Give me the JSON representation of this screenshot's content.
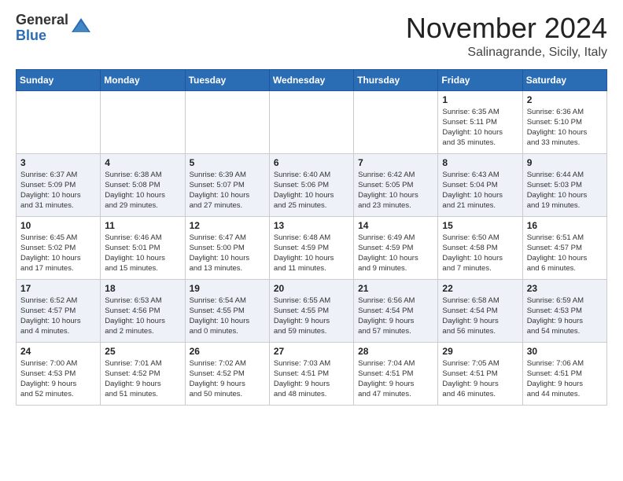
{
  "logo": {
    "general": "General",
    "blue": "Blue"
  },
  "header": {
    "month": "November 2024",
    "location": "Salinagrande, Sicily, Italy"
  },
  "weekdays": [
    "Sunday",
    "Monday",
    "Tuesday",
    "Wednesday",
    "Thursday",
    "Friday",
    "Saturday"
  ],
  "weeks": [
    [
      {
        "day": "",
        "info": ""
      },
      {
        "day": "",
        "info": ""
      },
      {
        "day": "",
        "info": ""
      },
      {
        "day": "",
        "info": ""
      },
      {
        "day": "",
        "info": ""
      },
      {
        "day": "1",
        "info": "Sunrise: 6:35 AM\nSunset: 5:11 PM\nDaylight: 10 hours\nand 35 minutes."
      },
      {
        "day": "2",
        "info": "Sunrise: 6:36 AM\nSunset: 5:10 PM\nDaylight: 10 hours\nand 33 minutes."
      }
    ],
    [
      {
        "day": "3",
        "info": "Sunrise: 6:37 AM\nSunset: 5:09 PM\nDaylight: 10 hours\nand 31 minutes."
      },
      {
        "day": "4",
        "info": "Sunrise: 6:38 AM\nSunset: 5:08 PM\nDaylight: 10 hours\nand 29 minutes."
      },
      {
        "day": "5",
        "info": "Sunrise: 6:39 AM\nSunset: 5:07 PM\nDaylight: 10 hours\nand 27 minutes."
      },
      {
        "day": "6",
        "info": "Sunrise: 6:40 AM\nSunset: 5:06 PM\nDaylight: 10 hours\nand 25 minutes."
      },
      {
        "day": "7",
        "info": "Sunrise: 6:42 AM\nSunset: 5:05 PM\nDaylight: 10 hours\nand 23 minutes."
      },
      {
        "day": "8",
        "info": "Sunrise: 6:43 AM\nSunset: 5:04 PM\nDaylight: 10 hours\nand 21 minutes."
      },
      {
        "day": "9",
        "info": "Sunrise: 6:44 AM\nSunset: 5:03 PM\nDaylight: 10 hours\nand 19 minutes."
      }
    ],
    [
      {
        "day": "10",
        "info": "Sunrise: 6:45 AM\nSunset: 5:02 PM\nDaylight: 10 hours\nand 17 minutes."
      },
      {
        "day": "11",
        "info": "Sunrise: 6:46 AM\nSunset: 5:01 PM\nDaylight: 10 hours\nand 15 minutes."
      },
      {
        "day": "12",
        "info": "Sunrise: 6:47 AM\nSunset: 5:00 PM\nDaylight: 10 hours\nand 13 minutes."
      },
      {
        "day": "13",
        "info": "Sunrise: 6:48 AM\nSunset: 4:59 PM\nDaylight: 10 hours\nand 11 minutes."
      },
      {
        "day": "14",
        "info": "Sunrise: 6:49 AM\nSunset: 4:59 PM\nDaylight: 10 hours\nand 9 minutes."
      },
      {
        "day": "15",
        "info": "Sunrise: 6:50 AM\nSunset: 4:58 PM\nDaylight: 10 hours\nand 7 minutes."
      },
      {
        "day": "16",
        "info": "Sunrise: 6:51 AM\nSunset: 4:57 PM\nDaylight: 10 hours\nand 6 minutes."
      }
    ],
    [
      {
        "day": "17",
        "info": "Sunrise: 6:52 AM\nSunset: 4:57 PM\nDaylight: 10 hours\nand 4 minutes."
      },
      {
        "day": "18",
        "info": "Sunrise: 6:53 AM\nSunset: 4:56 PM\nDaylight: 10 hours\nand 2 minutes."
      },
      {
        "day": "19",
        "info": "Sunrise: 6:54 AM\nSunset: 4:55 PM\nDaylight: 10 hours\nand 0 minutes."
      },
      {
        "day": "20",
        "info": "Sunrise: 6:55 AM\nSunset: 4:55 PM\nDaylight: 9 hours\nand 59 minutes."
      },
      {
        "day": "21",
        "info": "Sunrise: 6:56 AM\nSunset: 4:54 PM\nDaylight: 9 hours\nand 57 minutes."
      },
      {
        "day": "22",
        "info": "Sunrise: 6:58 AM\nSunset: 4:54 PM\nDaylight: 9 hours\nand 56 minutes."
      },
      {
        "day": "23",
        "info": "Sunrise: 6:59 AM\nSunset: 4:53 PM\nDaylight: 9 hours\nand 54 minutes."
      }
    ],
    [
      {
        "day": "24",
        "info": "Sunrise: 7:00 AM\nSunset: 4:53 PM\nDaylight: 9 hours\nand 52 minutes."
      },
      {
        "day": "25",
        "info": "Sunrise: 7:01 AM\nSunset: 4:52 PM\nDaylight: 9 hours\nand 51 minutes."
      },
      {
        "day": "26",
        "info": "Sunrise: 7:02 AM\nSunset: 4:52 PM\nDaylight: 9 hours\nand 50 minutes."
      },
      {
        "day": "27",
        "info": "Sunrise: 7:03 AM\nSunset: 4:51 PM\nDaylight: 9 hours\nand 48 minutes."
      },
      {
        "day": "28",
        "info": "Sunrise: 7:04 AM\nSunset: 4:51 PM\nDaylight: 9 hours\nand 47 minutes."
      },
      {
        "day": "29",
        "info": "Sunrise: 7:05 AM\nSunset: 4:51 PM\nDaylight: 9 hours\nand 46 minutes."
      },
      {
        "day": "30",
        "info": "Sunrise: 7:06 AM\nSunset: 4:51 PM\nDaylight: 9 hours\nand 44 minutes."
      }
    ]
  ]
}
